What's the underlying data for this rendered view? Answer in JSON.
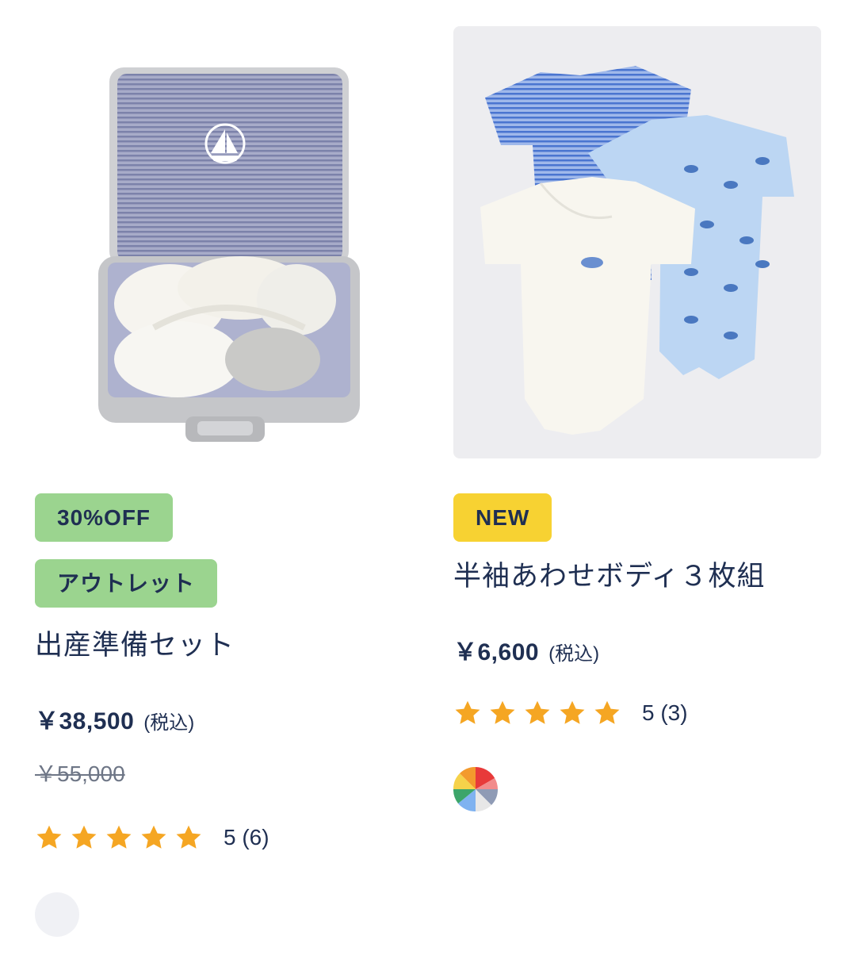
{
  "products": [
    {
      "badges": [
        "30%OFF",
        "アウトレット"
      ],
      "name": "出産準備セット",
      "price": "￥38,500",
      "tax_label": "(税込)",
      "original_price": "￥55,000",
      "rating": "5",
      "review_count": "(6)",
      "stars": 5,
      "swatch": "gray",
      "image_icon": "gift-set-suitcase-image"
    },
    {
      "badges": [
        "NEW"
      ],
      "name": "半袖あわせボディ３枚組",
      "price": "￥6,600",
      "tax_label": "(税込)",
      "rating": "5",
      "review_count": "(3)",
      "stars": 5,
      "swatch": "multicolor",
      "image_icon": "bodysuits-three-pack-image"
    }
  ],
  "colors": {
    "text": "#1f2f52",
    "badge_green": "#9bd48f",
    "badge_yellow": "#f7d232",
    "star": "#f5a623",
    "image_bg": "#ededf0"
  }
}
